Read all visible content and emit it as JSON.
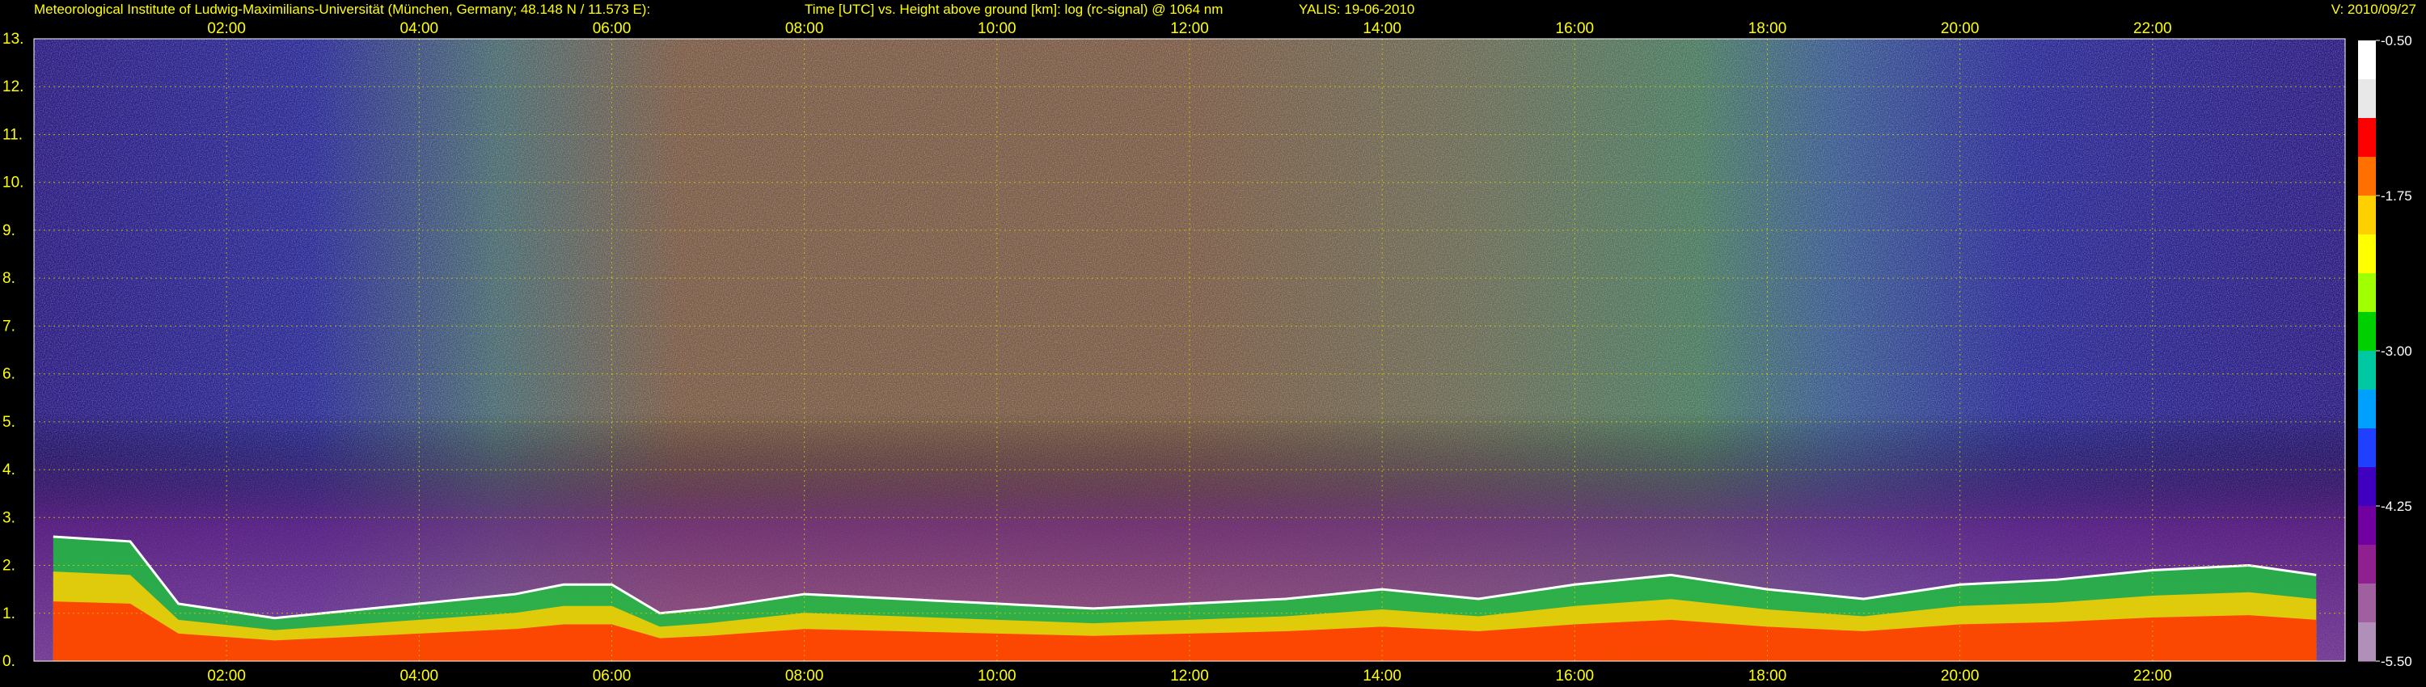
{
  "header": {
    "institute": "Meteorological Institute of Ludwig-Maximilians-Universität (München, Germany; 48.148 N / 11.573 E):",
    "description": "Time [UTC] vs. Height above ground [km]: log (rc-signal) @ 1064 nm",
    "instrument_date": "YALIS: 19-06-2010",
    "version": "V: 2010/09/27"
  },
  "chart_data": {
    "type": "heatmap",
    "title": "Time [UTC] vs. Height above ground [km]: log (rc-signal) @ 1064 nm",
    "xlabel": "Time [UTC]",
    "ylabel": "Height above ground [km]",
    "x_tick_labels": [
      "02:00",
      "04:00",
      "06:00",
      "08:00",
      "10:00",
      "12:00",
      "14:00",
      "16:00",
      "18:00",
      "20:00",
      "22:00"
    ],
    "x_tick_hours": [
      2,
      4,
      6,
      8,
      10,
      12,
      14,
      16,
      18,
      20,
      22
    ],
    "xlim_hours": [
      0,
      24
    ],
    "y_tick_labels": [
      "0.",
      "1.",
      "2.",
      "3.",
      "4.",
      "5.",
      "6.",
      "7.",
      "8.",
      "9.",
      "10.",
      "11.",
      "12.",
      "13."
    ],
    "y_tick_values": [
      0,
      1,
      2,
      3,
      4,
      5,
      6,
      7,
      8,
      9,
      10,
      11,
      12,
      13
    ],
    "ylim_km": [
      0,
      13
    ],
    "grid": true,
    "colorbar": {
      "range": [
        -5.5,
        -0.5
      ],
      "tick_labels": [
        "-0.50",
        "-1.75",
        "-3.00",
        "-4.25",
        "-5.50"
      ],
      "tick_values": [
        -0.5,
        -1.75,
        -3.0,
        -4.25,
        -5.5
      ],
      "colors": [
        "#ffffff",
        "#e8e8e8",
        "#ff0000",
        "#ff7000",
        "#ffd000",
        "#ffff00",
        "#a0ff00",
        "#00d000",
        "#00c8a0",
        "#00a0ff",
        "#2040ff",
        "#4000c0",
        "#7000a0",
        "#902090",
        "#a060a0",
        "#b090b8"
      ]
    },
    "boundary_layer_top_km": [
      [
        0.2,
        2.6
      ],
      [
        1.0,
        2.5
      ],
      [
        1.5,
        1.2
      ],
      [
        2.5,
        0.9
      ],
      [
        3.0,
        1.0
      ],
      [
        4.0,
        1.2
      ],
      [
        5.0,
        1.4
      ],
      [
        5.5,
        1.6
      ],
      [
        6.0,
        1.6
      ],
      [
        6.5,
        1.0
      ],
      [
        7.0,
        1.1
      ],
      [
        8.0,
        1.4
      ],
      [
        9.0,
        1.3
      ],
      [
        10.0,
        1.2
      ],
      [
        11.0,
        1.1
      ],
      [
        12.0,
        1.2
      ],
      [
        13.0,
        1.3
      ],
      [
        14.0,
        1.5
      ],
      [
        15.0,
        1.3
      ],
      [
        16.0,
        1.6
      ],
      [
        17.0,
        1.8
      ],
      [
        18.0,
        1.5
      ],
      [
        19.0,
        1.3
      ],
      [
        20.0,
        1.6
      ],
      [
        21.0,
        1.7
      ],
      [
        22.0,
        1.9
      ],
      [
        23.0,
        2.0
      ],
      [
        23.7,
        1.8
      ]
    ]
  }
}
